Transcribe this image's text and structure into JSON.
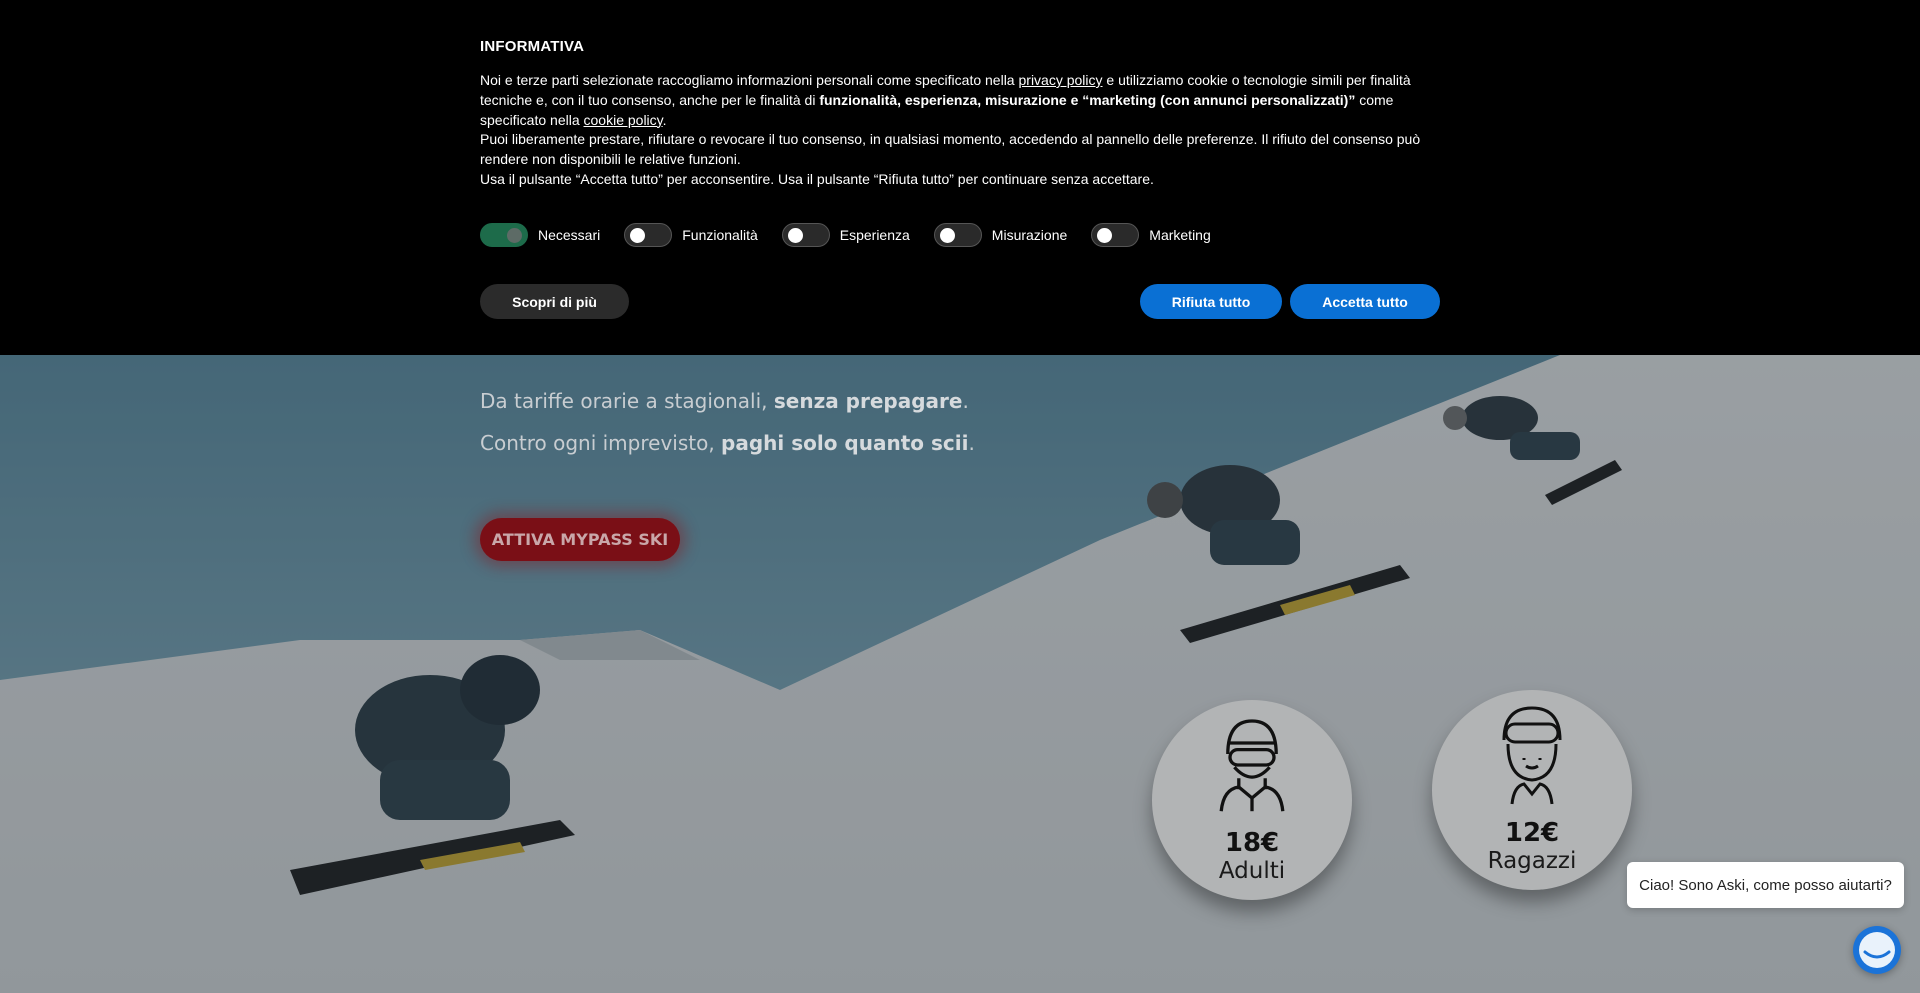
{
  "cookie_banner": {
    "title": "INFORMATIVA",
    "p1_a": "Noi e terze parti selezionate raccogliamo informazioni personali come specificato nella ",
    "privacy_link": "privacy policy",
    "p1_b": " e utilizziamo cookie o tecnologie simili per finalità tecniche e, con il tuo consenso, anche per le finalità di ",
    "p1_bold": "funzionalità, esperienza, misurazione e “marketing (con annunci personalizzati)”",
    "p1_c": " come specificato nella ",
    "cookie_link": "cookie policy",
    "p1_d": ".",
    "p2": "Puoi liberamente prestare, rifiutare o revocare il tuo consenso, in qualsiasi momento, accedendo al pannello delle preferenze. Il rifiuto del consenso può rendere non disponibili le relative funzioni.",
    "p3": "Usa il pulsante “Accetta tutto” per acconsentire. Usa il pulsante “Rifiuta tutto” per continuare senza accettare.",
    "toggles": [
      {
        "label": "Necessari",
        "on": true
      },
      {
        "label": "Funzionalità",
        "on": false
      },
      {
        "label": "Esperienza",
        "on": false
      },
      {
        "label": "Misurazione",
        "on": false
      },
      {
        "label": "Marketing",
        "on": false
      }
    ],
    "learn_more": "Scopri di più",
    "reject_all": "Rifiuta tutto",
    "accept_all": "Accetta tutto",
    "colors": {
      "primary_button": "#0a70d4",
      "toggle_on": "#1d6b4a"
    }
  },
  "hero": {
    "line1_a": "Da tariffe orarie a stagionali, ",
    "line1_bold": "senza prepagare",
    "line1_end": ".",
    "line2_a": "Contro ogni imprevisto, ",
    "line2_bold": "paghi solo quanto scii",
    "line2_end": ".",
    "cta": "ATTIVA MYPASS SKI",
    "cta_color": "#7a0f16"
  },
  "prices": [
    {
      "amount": "18€",
      "label": "Adulti",
      "icon": "adult-skier-icon"
    },
    {
      "amount": "12€",
      "label": "Ragazzi",
      "icon": "kid-skier-icon"
    }
  ],
  "chat": {
    "bubble_text": " Ciao! Sono Aski, come posso aiutarti?",
    "icon": "chat-avatar-icon"
  }
}
